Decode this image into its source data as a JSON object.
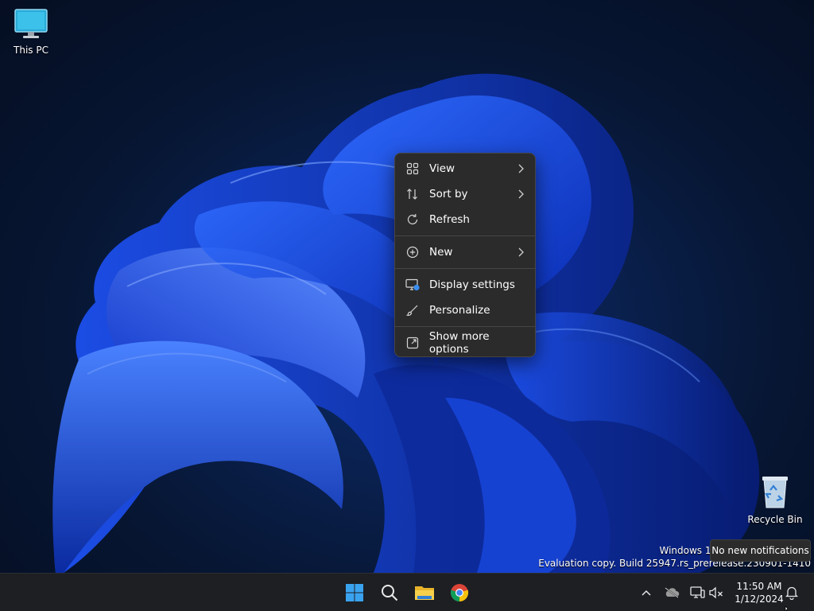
{
  "desktop": {
    "icons": [
      {
        "label": "This PC"
      },
      {
        "label": "Recycle Bin"
      }
    ],
    "watermark": {
      "line1": "Windows 11 Pro Insider Preview",
      "line2": "Evaluation copy. Build 25947.rs_prerelease.230901-1410"
    }
  },
  "context_menu": {
    "items": [
      {
        "label": "View",
        "icon": "grid-icon",
        "submenu": true
      },
      {
        "label": "Sort by",
        "icon": "sort-arrows-icon",
        "submenu": true
      },
      {
        "label": "Refresh",
        "icon": "refresh-icon",
        "submenu": false
      },
      {
        "label": "New",
        "icon": "plus-circle-icon",
        "submenu": true
      },
      {
        "label": "Display settings",
        "icon": "display-settings-icon",
        "submenu": false
      },
      {
        "label": "Personalize",
        "icon": "brush-icon",
        "submenu": false
      },
      {
        "label": "Show more options",
        "icon": "open-external-icon",
        "submenu": false
      }
    ]
  },
  "tooltip": {
    "text": "No new notifications"
  },
  "taskbar": {
    "apps": [
      "start-icon",
      "search-icon",
      "file-explorer-icon",
      "chrome-icon"
    ],
    "clock": {
      "time": "11:50 AM",
      "date": "1/12/2024"
    }
  },
  "colors": {
    "accent": "#3a6df0",
    "menu_bg": "#2b2b2b",
    "taskbar_bg": "#1d1f23"
  }
}
